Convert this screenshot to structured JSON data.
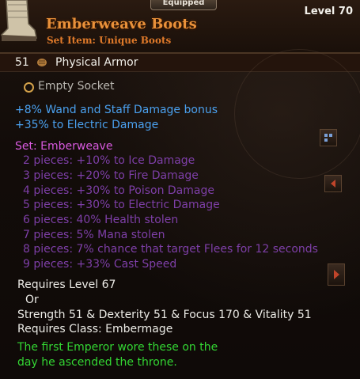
{
  "header": {
    "equipped_label": "Equipped",
    "item_name": "Emberweave Boots",
    "item_type": "Set Item: Unique Boots",
    "level_label": "Level 70",
    "icon": "boot-icon"
  },
  "armor": {
    "value": "51",
    "label": "Physical Armor",
    "icon": "armor-fist-icon"
  },
  "socket": {
    "label": "Empty Socket",
    "icon": "socket-ring-icon"
  },
  "bonuses": [
    "+8% Wand and Staff Damage bonus",
    "+35% to Electric Damage"
  ],
  "set": {
    "title": "Set: Emberweave",
    "pieces": [
      "2 pieces: +10% to Ice Damage",
      "3 pieces: +20% to Fire Damage",
      "4 pieces: +30% to Poison Damage",
      "5 pieces: +30% to Electric Damage",
      "6 pieces: 40% Health stolen",
      "7 pieces: 5% Mana stolen",
      "8 pieces: 7% chance that target Flees for 12 seconds",
      "9 pieces: +33% Cast Speed"
    ]
  },
  "requirements": {
    "level": "Requires Level 67",
    "or": "Or",
    "stats": "Strength 51 & Dexterity 51 & Focus 170 & Vitality 51",
    "class": "Requires Class: Embermage"
  },
  "flavor": [
    "The first Emperor wore these on the",
    "day he ascended the throne."
  ],
  "colors": {
    "name": "#e9913a",
    "bonus": "#4aa0ee",
    "set_active": "#d95ae0",
    "set_inactive": "#7e3fa8",
    "flavor": "#33d633"
  }
}
